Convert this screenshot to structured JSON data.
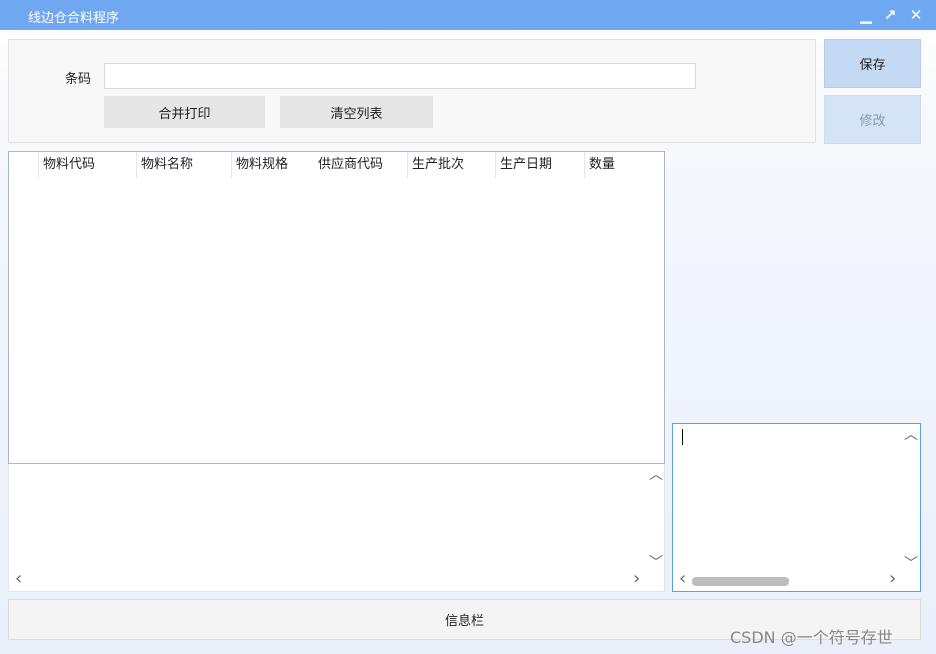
{
  "window": {
    "title": "线边仓合料程序",
    "min_glyph": "▁",
    "max_glyph": "↗",
    "close_glyph": "✕"
  },
  "form": {
    "barcode_label": "条码",
    "barcode_value": ""
  },
  "buttons": {
    "merge_print": "合并打印",
    "clear_list": "清空列表",
    "save": "保存",
    "modify": "修改"
  },
  "grid": {
    "columns": [
      "物料代码",
      "物料名称",
      "物料规格",
      "供应商代码",
      "生产批次",
      "生产日期",
      "数量"
    ],
    "rows": []
  },
  "scroll": {
    "up": "︿",
    "down": "﹀",
    "left": "‹",
    "right": "›"
  },
  "status": {
    "info_bar": "信息栏"
  },
  "watermark": "CSDN @一个符号存世"
}
